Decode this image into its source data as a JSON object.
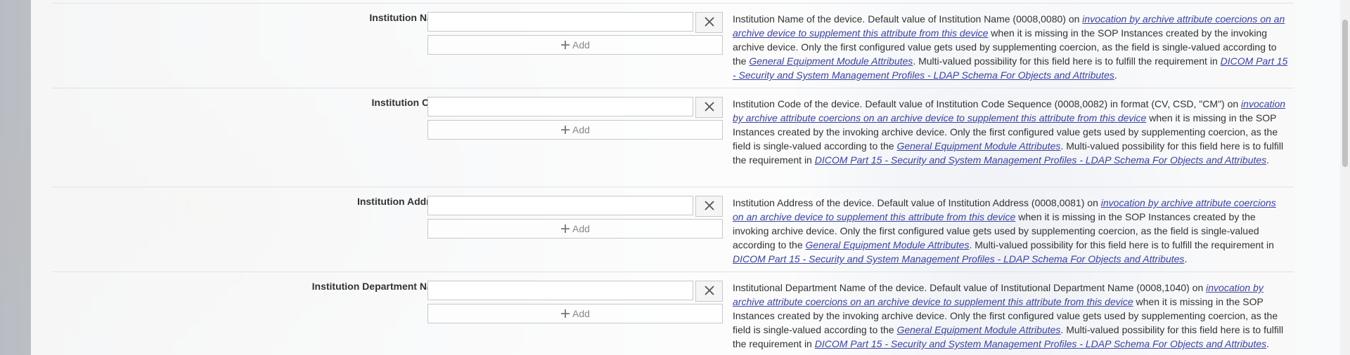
{
  "fields": [
    {
      "label": "Institution Name",
      "input_value": "",
      "add_label": "Add",
      "desc": {
        "t1": "Institution Name of the device. Default value of Institution Name (0008,0080) on ",
        "l1": "invocation by archive attribute coercions on an archive device to supplement this attribute from this device",
        "t2": " when it is missing in the SOP Instances created by the invoking archive device. Only the first configured value gets used by supplementing coercion, as the field is single-valued according to the ",
        "l2": "General Equipment Module Attributes",
        "t3": ". Multi-valued possibility for this field here is to fulfill the requirement in ",
        "l3": "DICOM Part 15 - Security and System Management Profiles - LDAP Schema For Objects and Attributes",
        "t4": "."
      }
    },
    {
      "label": "Institution Code",
      "input_value": "",
      "add_label": "Add",
      "desc": {
        "t1": "Institution Code of the device. Default value of Institution Code Sequence (0008,0082) in format (CV, CSD, \"CM\") on ",
        "l1": "invocation by archive attribute coercions on an archive device to supplement this attribute from this device",
        "t2": " when it is missing in the SOP Instances created by the invoking archive device. Only the first configured value gets used by supplementing coercion, as the field is single-valued according to the ",
        "l2": "General Equipment Module Attributes",
        "t3": ". Multi-valued possibility for this field here is to fulfill the requirement in ",
        "l3": "DICOM Part 15 - Security and System Management Profiles - LDAP Schema For Objects and Attributes",
        "t4": "."
      }
    },
    {
      "label": "Institution Address",
      "input_value": "",
      "add_label": "Add",
      "desc": {
        "t1": "Institution Address of the device. Default value of Institution Address (0008,0081) on ",
        "l1": "invocation by archive attribute coercions on an archive device to supplement this attribute from this device",
        "t2": " when it is missing in the SOP Instances created by the invoking archive device. Only the first configured value gets used by supplementing coercion, as the field is single-valued according to the ",
        "l2": "General Equipment Module Attributes",
        "t3": ". Multi-valued possibility for this field here is to fulfill the requirement in ",
        "l3": "DICOM Part 15 - Security and System Management Profiles - LDAP Schema For Objects and Attributes",
        "t4": "."
      }
    },
    {
      "label": "Institution Department Name",
      "input_value": "",
      "add_label": "Add",
      "desc": {
        "t1": "Institutional Department Name of the device. Default value of Institutional Department Name (0008,1040) on ",
        "l1": "invocation by archive attribute coercions on an archive device to supplement this attribute from this device",
        "t2": " when it is missing in the SOP Instances created by the invoking archive device. Only the first configured value gets used by supplementing coercion, as the field is single-valued according to the ",
        "l2": "General Equipment Module Attributes",
        "t3": ". Multi-valued possibility for this field here is to fulfill the requirement in ",
        "l3": "DICOM Part 15 - Security and System Management Profiles - LDAP Schema For Objects and Attributes",
        "t4": "."
      }
    }
  ],
  "icons": {
    "clear": "close-icon",
    "add": "plus-icon"
  },
  "colors": {
    "link": "#3a43a6",
    "label": "#333333"
  }
}
